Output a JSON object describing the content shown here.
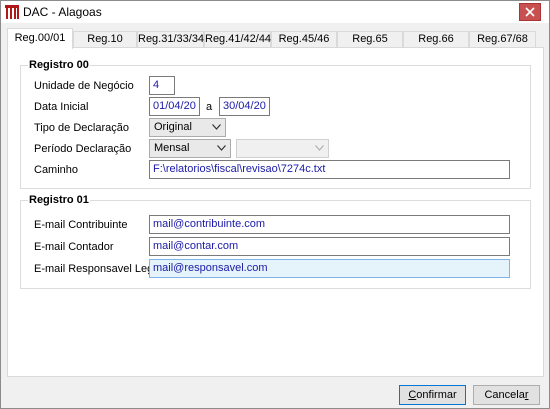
{
  "window": {
    "title": "DAC - Alagoas"
  },
  "tabs": [
    {
      "label": "Reg.00/01"
    },
    {
      "label": "Reg.10"
    },
    {
      "label": "Reg.31/33/34"
    },
    {
      "label": "Reg.41/42/44"
    },
    {
      "label": "Reg.45/46"
    },
    {
      "label": "Reg.65"
    },
    {
      "label": "Reg.66"
    },
    {
      "label": "Reg.67/68"
    }
  ],
  "registro00": {
    "title": "Registro 00",
    "unidade_label": "Unidade de Negócio",
    "unidade_value": "4",
    "data_inicial_label": "Data Inicial",
    "data_inicial_value": "01/04/20",
    "data_sep": "a",
    "data_final_value": "30/04/20",
    "tipo_label": "Tipo de Declaração",
    "tipo_value": "Original",
    "periodo_label": "Período Declaração",
    "periodo_value": "Mensal",
    "periodo_secondary_value": "",
    "caminho_label": "Caminho",
    "caminho_value": "F:\\relatorios\\fiscal\\revisao\\7274c.txt"
  },
  "registro01": {
    "title": "Registro 01",
    "contribuinte_label": "E-mail Contribuinte",
    "contribuinte_value": "mail@contribuinte.com",
    "contador_label": "E-mail Contador",
    "contador_value": "mail@contar.com",
    "responsavel_label": "E-mail Responsavel Legal",
    "responsavel_value": "mail@responsavel.com"
  },
  "buttons": {
    "confirmar_prefix": "",
    "confirmar_ul": "C",
    "confirmar_rest": "onfirmar",
    "cancelar_prefix": "Cancela",
    "cancelar_ul": "r",
    "cancelar_rest": ""
  }
}
